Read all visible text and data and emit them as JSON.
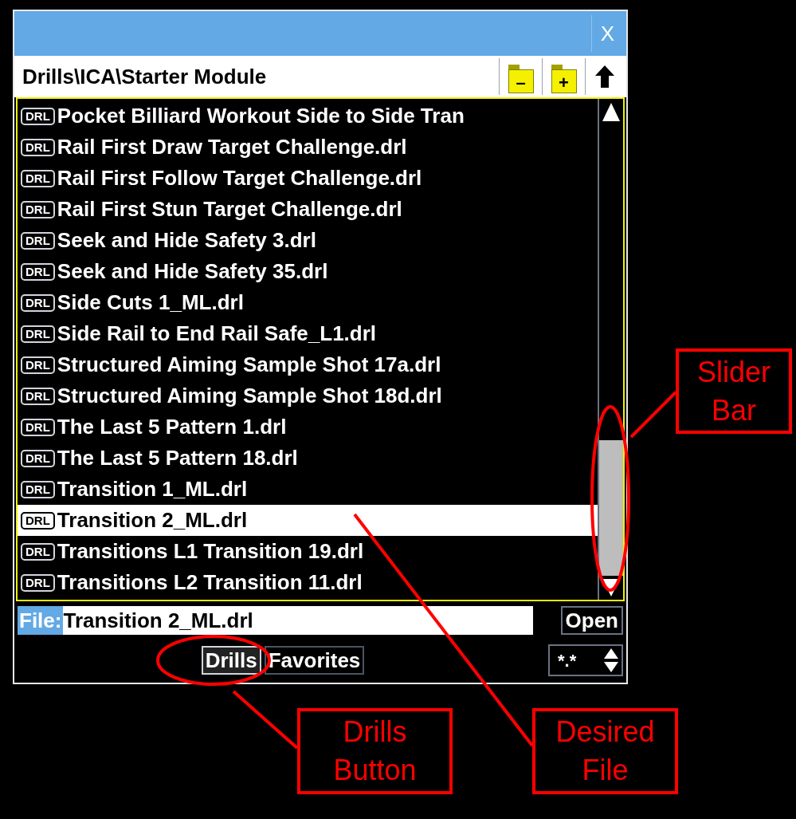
{
  "window": {
    "close": "X"
  },
  "path_bar": {
    "path": "Drills\\ICA\\Starter Module",
    "buttons": [
      {
        "kind": "folder_minus",
        "glyph": "–"
      },
      {
        "kind": "folder_plus",
        "glyph": "+"
      },
      {
        "kind": "up"
      }
    ]
  },
  "files": [
    {
      "badge": "DRL",
      "name": "Pocket Billiard Workout Side to Side Tran",
      "selected": false
    },
    {
      "badge": "DRL",
      "name": "Rail First Draw Target Challenge.drl",
      "selected": false
    },
    {
      "badge": "DRL",
      "name": "Rail First Follow Target Challenge.drl",
      "selected": false
    },
    {
      "badge": "DRL",
      "name": "Rail First Stun Target Challenge.drl",
      "selected": false
    },
    {
      "badge": "DRL",
      "name": "Seek and Hide Safety 3.drl",
      "selected": false
    },
    {
      "badge": "DRL",
      "name": "Seek and Hide Safety 35.drl",
      "selected": false
    },
    {
      "badge": "DRL",
      "name": "Side Cuts 1_ML.drl",
      "selected": false
    },
    {
      "badge": "DRL",
      "name": "Side Rail to End Rail Safe_L1.drl",
      "selected": false
    },
    {
      "badge": "DRL",
      "name": "Structured Aiming Sample Shot 17a.drl",
      "selected": false
    },
    {
      "badge": "DRL",
      "name": "Structured Aiming Sample Shot 18d.drl",
      "selected": false
    },
    {
      "badge": "DRL",
      "name": "The Last 5 Pattern 1.drl",
      "selected": false
    },
    {
      "badge": "DRL",
      "name": "The Last 5 Pattern 18.drl",
      "selected": false
    },
    {
      "badge": "DRL",
      "name": "Transition 1_ML.drl",
      "selected": false
    },
    {
      "badge": "DRL",
      "name": "Transition 2_ML.drl",
      "selected": true
    },
    {
      "badge": "DRL",
      "name": "Transitions L1 Transition 19.drl",
      "selected": false
    },
    {
      "badge": "DRL",
      "name": "Transitions L2 Transition 11.drl",
      "selected": false
    }
  ],
  "file_row": {
    "label": "File:",
    "value": "Transition 2_ML.drl",
    "button": "Open"
  },
  "bottom": {
    "tabs": [
      {
        "label": "Drills",
        "selected": true
      },
      {
        "label": "Favorites",
        "selected": false
      }
    ],
    "filter": "*.*"
  },
  "callouts": [
    {
      "kind": "slider",
      "lines": [
        "Slider",
        "Bar"
      ]
    },
    {
      "kind": "drills",
      "lines": [
        "Drills",
        "Button"
      ]
    },
    {
      "kind": "file",
      "lines": [
        "Desired",
        "File"
      ]
    }
  ]
}
